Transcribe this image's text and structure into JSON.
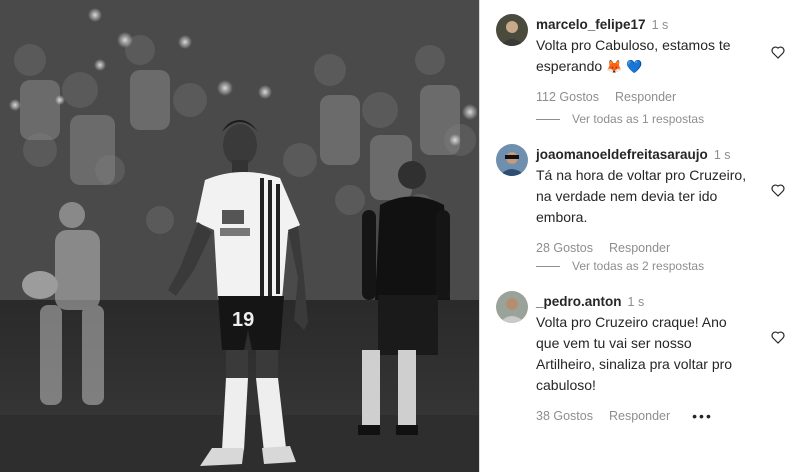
{
  "comments": [
    {
      "username": "marcelo_felipe17",
      "time": "1 s",
      "text": "Volta pro Cabuloso, estamos te esperando",
      "emoji_1": "🦊",
      "emoji_2": "💙",
      "likes": "112 Gostos",
      "reply_label": "Responder",
      "avatar_icon": "user-avatar"
    },
    {
      "username": "joaomanoeldefreitasaraujo",
      "time": "1 s",
      "text": "Tá na hora de voltar pro Cruzeiro, na verdade nem devia ter ido embora.",
      "likes": "28 Gostos",
      "reply_label": "Responder",
      "avatar_icon": "user-avatar"
    },
    {
      "username": "_pedro.anton",
      "time": "1 s",
      "text": "Volta pro Cruzeiro craque! Ano que vem tu vai ser nosso Artilheiro, sinaliza pra voltar pro cabuloso!",
      "likes": "38 Gostos",
      "reply_label": "Responder",
      "more_label": "•••",
      "avatar_icon": "user-avatar"
    }
  ],
  "view_replies": [
    "Ver todas as 1 respostas",
    "Ver todas as 2 respostas"
  ],
  "photo": {
    "jersey_number": "19",
    "style": "black-and-white"
  },
  "colors": {
    "text": "#262626",
    "secondary": "#8e8e8e",
    "divider": "#dbdbdb",
    "heart_blue": "#1877f2",
    "fox_orange": "#f58529"
  }
}
